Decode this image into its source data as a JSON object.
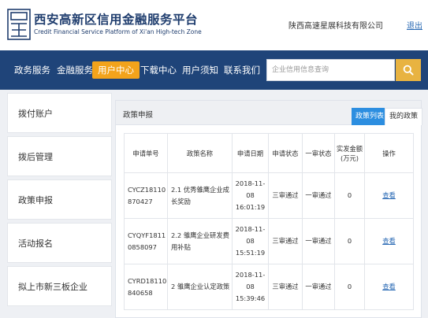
{
  "header": {
    "title": "西安高新区信用金融服务平台",
    "subtitle": "Credit Financial Service Platform of Xi'an High-tech Zone",
    "company": "陕西高速星展科技有限公司",
    "logout_label": "退出"
  },
  "nav": {
    "items": [
      {
        "label": "政务服务"
      },
      {
        "label": "金融服务"
      },
      {
        "label": "用户中心"
      },
      {
        "label": "下载中心"
      },
      {
        "label": "用户须知"
      },
      {
        "label": "联系我们"
      }
    ],
    "active": "用户中心",
    "search_placeholder": "企业信用信息查询",
    "search_icon": "search-icon"
  },
  "sidebar": {
    "items": [
      {
        "label": "拨付账户"
      },
      {
        "label": "拨后管理"
      },
      {
        "label": "政策申报"
      },
      {
        "label": "活动报名"
      },
      {
        "label": "拟上市新三板企业"
      }
    ]
  },
  "panel": {
    "title": "政策申报",
    "tabs": [
      {
        "label": "政策列表",
        "active": true
      },
      {
        "label": "我的政策",
        "active": false
      }
    ],
    "table": {
      "headers": [
        "申请单号",
        "政策名称",
        "申请日期",
        "申请状态",
        "一审状态",
        "实发金额(万元)",
        "操作"
      ],
      "rows": [
        {
          "id": "CYCZ18110870427",
          "name": "2.1 优秀雏鹰企业成长奖励",
          "date": "2018-11-08 16:01:19",
          "status": "三审通过",
          "first_review": "一审通过",
          "amount": "0",
          "action": "查看"
        },
        {
          "id": "CYQYF18110858097",
          "name": "2.2 雏鹰企业研发费用补贴",
          "date": "2018-11-08 15:51:19",
          "status": "三审通过",
          "first_review": "一审通过",
          "amount": "0",
          "action": "查看"
        },
        {
          "id": "CYRD18110840658",
          "name": "2 雏鹰企业认定政策",
          "date": "2018-11-08 15:39:46",
          "status": "三审通过",
          "first_review": "一审通过",
          "amount": "0",
          "action": "查看"
        }
      ]
    }
  },
  "colors": {
    "nav_bg": "#1f4479",
    "nav_active": "#f3a31b",
    "search_button": "#e8b341",
    "tab_active": "#2c8ee0",
    "link": "#2a6ab4",
    "brand": "#1f3d6e"
  }
}
